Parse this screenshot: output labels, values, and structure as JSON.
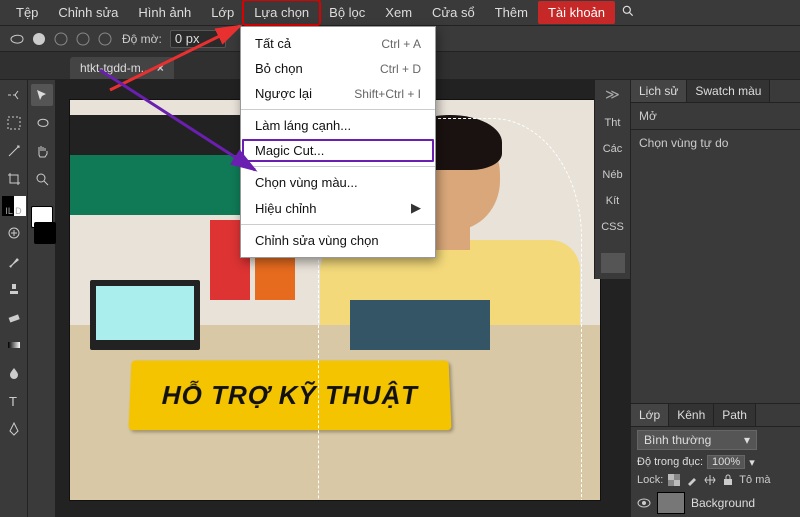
{
  "menubar": {
    "items": [
      "Tệp",
      "Chỉnh sửa",
      "Hình ảnh",
      "Lớp",
      "Lựa chọn",
      "Bộ lọc",
      "Xem",
      "Cửa sổ",
      "Thêm"
    ],
    "account": "Tài khoản",
    "highlighted_index": 4
  },
  "toolbar": {
    "opacity_label": "Độ mờ:",
    "opacity_value": "0 px"
  },
  "tabs": {
    "filename": "htkt-tgdd-m..."
  },
  "dropdown": {
    "items": [
      {
        "label": "Tất cả",
        "shortcut": "Ctrl + A",
        "sep": false
      },
      {
        "label": "Bỏ chọn",
        "shortcut": "Ctrl + D",
        "sep": false
      },
      {
        "label": "Ngược lại",
        "shortcut": "Shift+Ctrl + I",
        "sep": true
      },
      {
        "label": "Làm láng cạnh...",
        "shortcut": "",
        "sep": false
      },
      {
        "label": "Magic Cut...",
        "shortcut": "",
        "sep": true,
        "mc": true
      },
      {
        "label": "Chọn vùng màu...",
        "shortcut": "",
        "sep": false
      },
      {
        "label": "Hiệu chỉnh",
        "shortcut": "",
        "sep": true,
        "submenu": true
      },
      {
        "label": "Chỉnh sửa vùng chọn",
        "shortcut": "",
        "sep": false
      }
    ]
  },
  "canvas_sign": "HỖ TRỢ KỸ THUẬT",
  "mini": [
    "Tht",
    "Các",
    "Néb",
    "Kít",
    "CSS"
  ],
  "history": {
    "tabs": [
      "Lịch sử",
      "Swatch màu"
    ],
    "items": [
      "Mở",
      "Chọn vùng tự do"
    ]
  },
  "layers": {
    "tabs": [
      "Lớp",
      "Kênh",
      "Path"
    ],
    "mode": "Bình thường",
    "opacity_label": "Độ trong đục:",
    "opacity_value": "100%",
    "lock_label": "Lock:",
    "fill_label": "Tô mà",
    "items": [
      {
        "name": "Background"
      }
    ]
  },
  "tool_filter": "IL D"
}
